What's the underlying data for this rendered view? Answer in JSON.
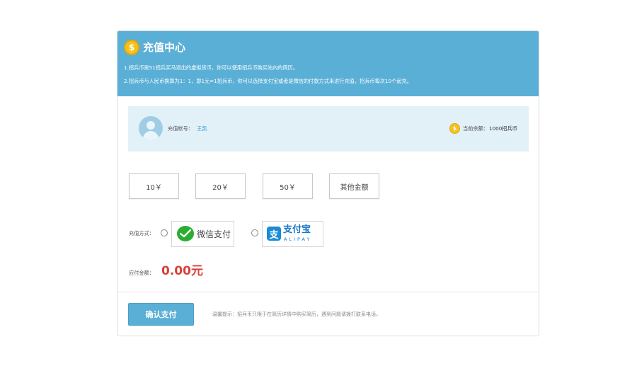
{
  "header": {
    "coin_symbol": "$",
    "title": "充值中心",
    "notices": [
      "1.招兵币是51招兵买马退出的虚拟货币，你可以使用招兵币购买站内的简历。",
      "2.招兵币与人民币换算为1：1，即1元=1招兵币，你可以选择支付宝或者是微信的付款方式来进行充值，招兵币每次10个起充。"
    ],
    "color": "#5aafd6"
  },
  "account": {
    "label": "充值帐号：",
    "name": "王凯",
    "coin_symbol": "$",
    "balance_label": "当前余额：",
    "balance_value": "1000招兵币"
  },
  "amounts": [
    {
      "label": "10￥"
    },
    {
      "label": "20￥"
    },
    {
      "label": "50￥"
    },
    {
      "label": "其他金额"
    }
  ],
  "payment": {
    "label": "充值方式：",
    "wechat_label": "微信支付",
    "alipay_glyph": "支",
    "alipay_label": "支付宝",
    "alipay_sub": "ALIPAY"
  },
  "due": {
    "label": "应付金额：",
    "value": "0.00元",
    "color": "#d9403a"
  },
  "footer": {
    "confirm_label": "确认支付",
    "tip": "温馨提示：招兵币只限于在简历详情中购买简历，遇到问题请拨打联系电话。"
  }
}
